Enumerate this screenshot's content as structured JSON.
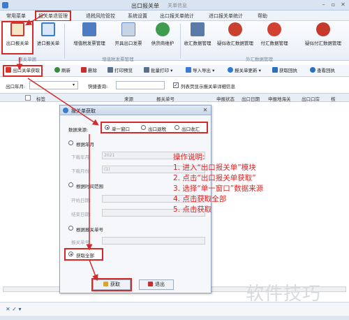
{
  "window": {
    "title": "出口报关单",
    "subtitle": "关单信息"
  },
  "menu": {
    "items": [
      "常用菜单",
      "报关单退管理",
      "退税风险管控",
      "系统设置",
      "出口报关单统计",
      "进口报关单统计",
      "帮助"
    ]
  },
  "ribbon": {
    "buttons": [
      {
        "label": "出口报关单",
        "icon": "export-declaration-icon",
        "color": "#d9342b"
      },
      {
        "label": "进口报关单",
        "icon": "import-declaration-icon",
        "color": "#3a7bd5"
      },
      {
        "label": "增值税发票管理",
        "icon": "vat-invoice-icon",
        "color": "#4f7cc0"
      },
      {
        "label": "开具出口发票",
        "icon": "issue-invoice-icon",
        "color": "#6c8fbf"
      },
      {
        "label": "供货商维护",
        "icon": "supplier-icon",
        "color": "#3f9b4d"
      },
      {
        "label": "收汇数据管理",
        "icon": "receipt-data-icon",
        "color": "#5a7aa8"
      },
      {
        "label": "疑似收汇数据管理",
        "icon": "suspect-receipt-icon",
        "color": "#c9402f"
      },
      {
        "label": "付汇数据管理",
        "icon": "payment-data-icon",
        "color": "#d24030"
      },
      {
        "label": "疑似付汇数据管理",
        "icon": "suspect-payment-icon",
        "color": "#c53a2c"
      }
    ],
    "groups": [
      "报关单据",
      "增值税发票管理",
      "外汇数据管理"
    ]
  },
  "toolbar": {
    "items": [
      {
        "label": "出口关单获取",
        "icon": "fetch-icon",
        "color": "#d9342b"
      },
      {
        "label": "刷新",
        "icon": "refresh-icon",
        "color": "#3b8a3b"
      },
      {
        "label": "删除",
        "icon": "delete-icon",
        "color": "#c43030"
      },
      {
        "label": "打印预览",
        "icon": "print-preview-icon",
        "color": "#5a6f8a"
      },
      {
        "label": "批量打印 ▾",
        "icon": "batch-print-icon",
        "color": "#5a6f8a"
      },
      {
        "label": "导入导出 ▾",
        "icon": "import-export-icon",
        "color": "#3a7bd5"
      },
      {
        "label": "报关单更新 ▾",
        "icon": "update-icon",
        "color": "#2d7bd0"
      },
      {
        "label": "获取回执",
        "icon": "receipt-icon",
        "color": "#2b6fbd"
      },
      {
        "label": "查看回执",
        "icon": "view-receipt-icon",
        "color": "#2b6fbd"
      }
    ]
  },
  "filter": {
    "month_label": "出口年月:",
    "month_value": "",
    "query_label": "快捷查询:",
    "checkbox_label": "列表页显示报关单详细信息"
  },
  "grid": {
    "columns": [
      "标签",
      "来源",
      "报关单号",
      "申报状态",
      "出口日期",
      "申报地海关",
      "出口口岸",
      "核"
    ]
  },
  "dialog": {
    "title": "报关单获取",
    "source_label": "数据来源:",
    "sources": [
      "单一窗口",
      "出口退税",
      "出口收汇"
    ],
    "selected_source": "单一窗口",
    "by_month_label": "根据年月",
    "start_month_label": "下载年月:",
    "start_month_value": "2021",
    "end_month_label": "下载月份:",
    "end_month_value": "(1)",
    "by_range_label": "根据时间范围",
    "range_start_label": "开始日期:",
    "range_end_label": "结束日期:",
    "by_number_label": "根据报关单号",
    "number_label": "报关单号:",
    "fetch_all_label": "获取全部",
    "ok_label": "获取",
    "exit_label": "退出"
  },
  "instructions": {
    "title": "操作说明:",
    "steps": [
      "1. 进入“出口报关单”模块",
      "2. 点击“出口报关单获取”",
      "3. 选择“单一窗口”数据来源",
      "4. 点击获取全部",
      "5. 点击获取"
    ]
  },
  "footer": {
    "filter_icons": "✕ ✓ ▾"
  },
  "watermark": "软件技巧",
  "colors": {
    "highlight": "#d42a2a",
    "instructions": "#e02222"
  }
}
